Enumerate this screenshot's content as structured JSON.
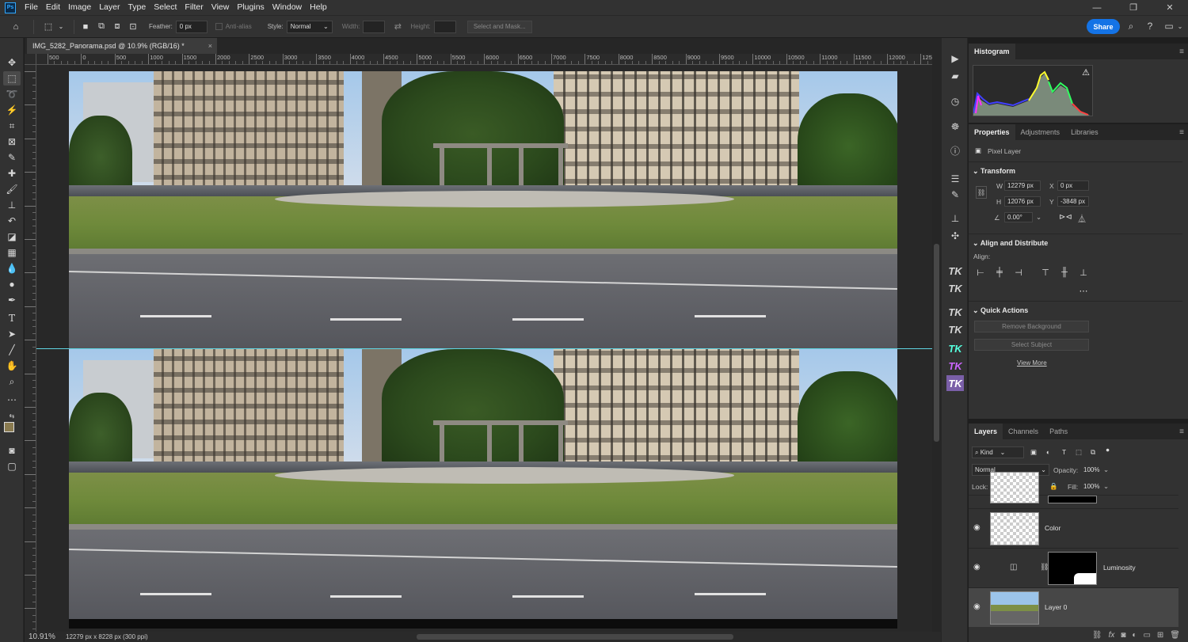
{
  "app": {
    "logo": "Ps"
  },
  "menu": {
    "items": [
      "File",
      "Edit",
      "Image",
      "Layer",
      "Type",
      "Select",
      "Filter",
      "View",
      "Plugins",
      "Window",
      "Help"
    ]
  },
  "window_controls": {
    "minimize": "—",
    "maximize": "❐",
    "close": "✕"
  },
  "options": {
    "feather_label": "Feather:",
    "feather_value": "0 px",
    "antialias_label": "Anti-alias",
    "style_label": "Style:",
    "style_value": "Normal",
    "width_label": "Width:",
    "height_label": "Height:",
    "select_mask_label": "Select and Mask...",
    "share_label": "Share"
  },
  "document": {
    "tab_title": "IMG_5282_Panorama.psd @ 10.9% (RGB/16) *",
    "close": "×"
  },
  "ruler": {
    "h_labels": [
      "500",
      "0",
      "500",
      "1000",
      "1500",
      "2000",
      "2500",
      "3000",
      "3500",
      "4000",
      "4500",
      "5000",
      "5500",
      "6000",
      "6500",
      "7000",
      "7500",
      "8000",
      "8500",
      "9000",
      "9500",
      "10000",
      "10500",
      "11000",
      "11500",
      "12000",
      "12500"
    ]
  },
  "status": {
    "zoom": "10.91%",
    "doc_info": "12279 px x 8228 px (300 ppi)"
  },
  "histogram": {
    "tab": "Histogram",
    "warning_icon": "⚠"
  },
  "properties": {
    "tabs": [
      "Properties",
      "Adjustments",
      "Libraries"
    ],
    "layer_type": "Pixel Layer",
    "transform_title": "Transform",
    "w_label": "W",
    "w_value": "12279 px",
    "h_label": "H",
    "h_value": "12076 px",
    "x_label": "X",
    "x_value": "0 px",
    "y_label": "Y",
    "y_value": "-3848 px",
    "angle_value": "0.00°",
    "align_title": "Align and Distribute",
    "align_label": "Align:",
    "quick_actions_title": "Quick Actions",
    "remove_bg": "Remove Background",
    "select_subject": "Select Subject",
    "view_more": "View More"
  },
  "layers": {
    "tabs": [
      "Layers",
      "Channels",
      "Paths"
    ],
    "filter_kind": "Kind",
    "blend_mode": "Normal",
    "opacity_label": "Opacity:",
    "opacity_value": "100%",
    "lock_label": "Lock:",
    "fill_label": "Fill:",
    "fill_value": "100%",
    "items": [
      {
        "name": "Color"
      },
      {
        "name": "Luminosity"
      },
      {
        "name": "Layer 0"
      }
    ]
  },
  "colors": {
    "accent": "#1473e6",
    "guide": "#5fd5e3",
    "foreground_swatch": "#8a7b50"
  }
}
